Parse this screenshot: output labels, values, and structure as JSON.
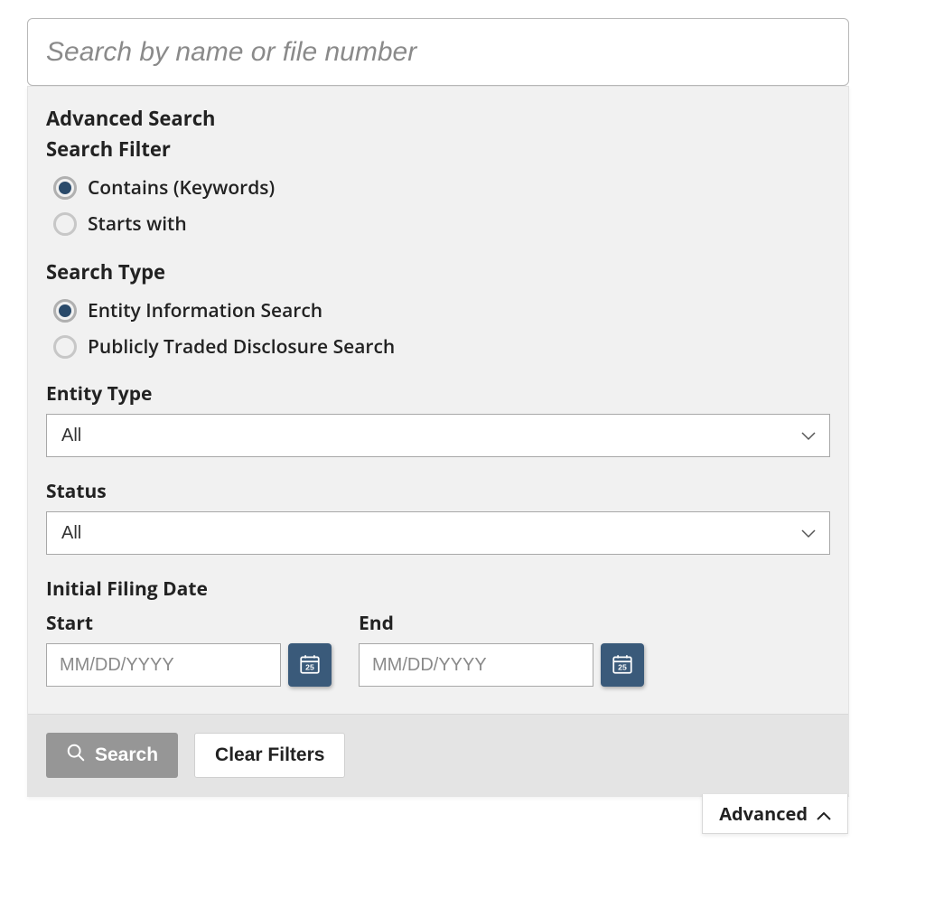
{
  "search": {
    "placeholder": "Search by name or file number",
    "value": ""
  },
  "advanced": {
    "title": "Advanced Search",
    "searchFilter": {
      "title": "Search Filter",
      "options": [
        "Contains (Keywords)",
        "Starts with"
      ],
      "selected": 0
    },
    "searchType": {
      "title": "Search Type",
      "options": [
        "Entity Information Search",
        "Publicly Traded Disclosure Search"
      ],
      "selected": 0
    },
    "entityType": {
      "label": "Entity Type",
      "value": "All"
    },
    "status": {
      "label": "Status",
      "value": "All"
    },
    "filingDate": {
      "label": "Initial Filing Date",
      "start": {
        "label": "Start",
        "placeholder": "MM/DD/YYYY",
        "value": ""
      },
      "end": {
        "label": "End",
        "placeholder": "MM/DD/YYYY",
        "value": ""
      }
    }
  },
  "footer": {
    "searchLabel": "Search",
    "clearLabel": "Clear Filters"
  },
  "toggle": {
    "label": "Advanced"
  }
}
